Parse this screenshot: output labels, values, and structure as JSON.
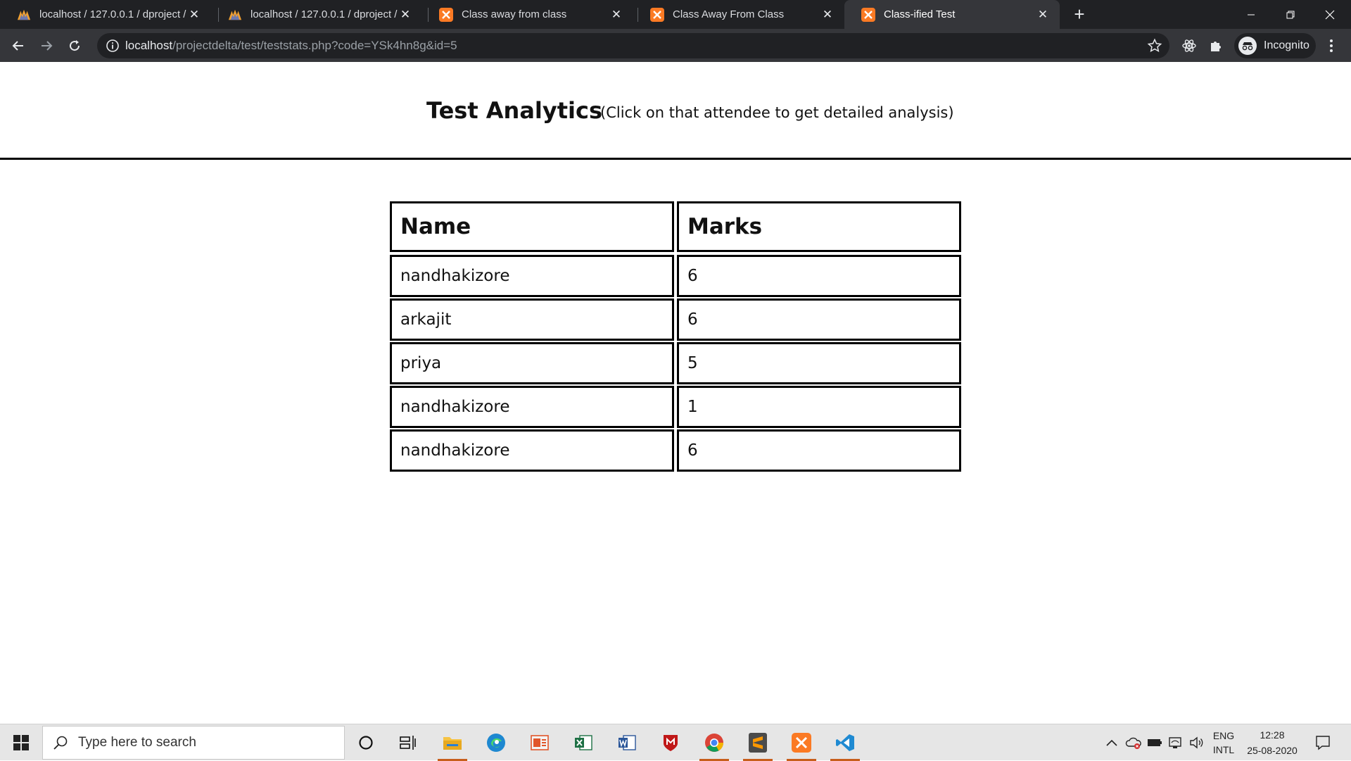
{
  "browser": {
    "tabs": [
      {
        "title": "localhost / 127.0.0.1 / dproject / ...",
        "icon": "phpmyadmin-icon",
        "active": false
      },
      {
        "title": "localhost / 127.0.0.1 / dproject / ...",
        "icon": "phpmyadmin-icon",
        "active": false
      },
      {
        "title": "Class away from class",
        "icon": "xampp-icon",
        "active": false
      },
      {
        "title": "Class Away From Class",
        "icon": "xampp-icon",
        "active": false
      },
      {
        "title": "Class-ified Test",
        "icon": "xampp-icon",
        "active": true
      }
    ],
    "close_glyph": "✕",
    "new_tab_glyph": "+",
    "url_host": "localhost",
    "url_path": "/projectdelta/test/teststats.php?code=YSk4hn8g&id=5",
    "profile_label": "Incognito"
  },
  "page": {
    "title": "Test Analytics",
    "hint": "(Click on that attendee to get detailed analysis)",
    "table": {
      "headers": [
        "Name",
        "Marks"
      ],
      "rows": [
        [
          "nandhakizore",
          "6"
        ],
        [
          "arkajit",
          "6"
        ],
        [
          "priya",
          "5"
        ],
        [
          "nandhakizore",
          "1"
        ],
        [
          "nandhakizore",
          "6"
        ]
      ]
    }
  },
  "taskbar": {
    "search_placeholder": "Type here to search",
    "language": "ENG",
    "layout": "INTL",
    "time": "12:28",
    "date": "25-08-2020"
  },
  "colors": {
    "tab_bar": "#202124",
    "toolbar": "#35363a",
    "xampp_orange": "#fb7a24",
    "taskbar": "#e6e6e6"
  }
}
